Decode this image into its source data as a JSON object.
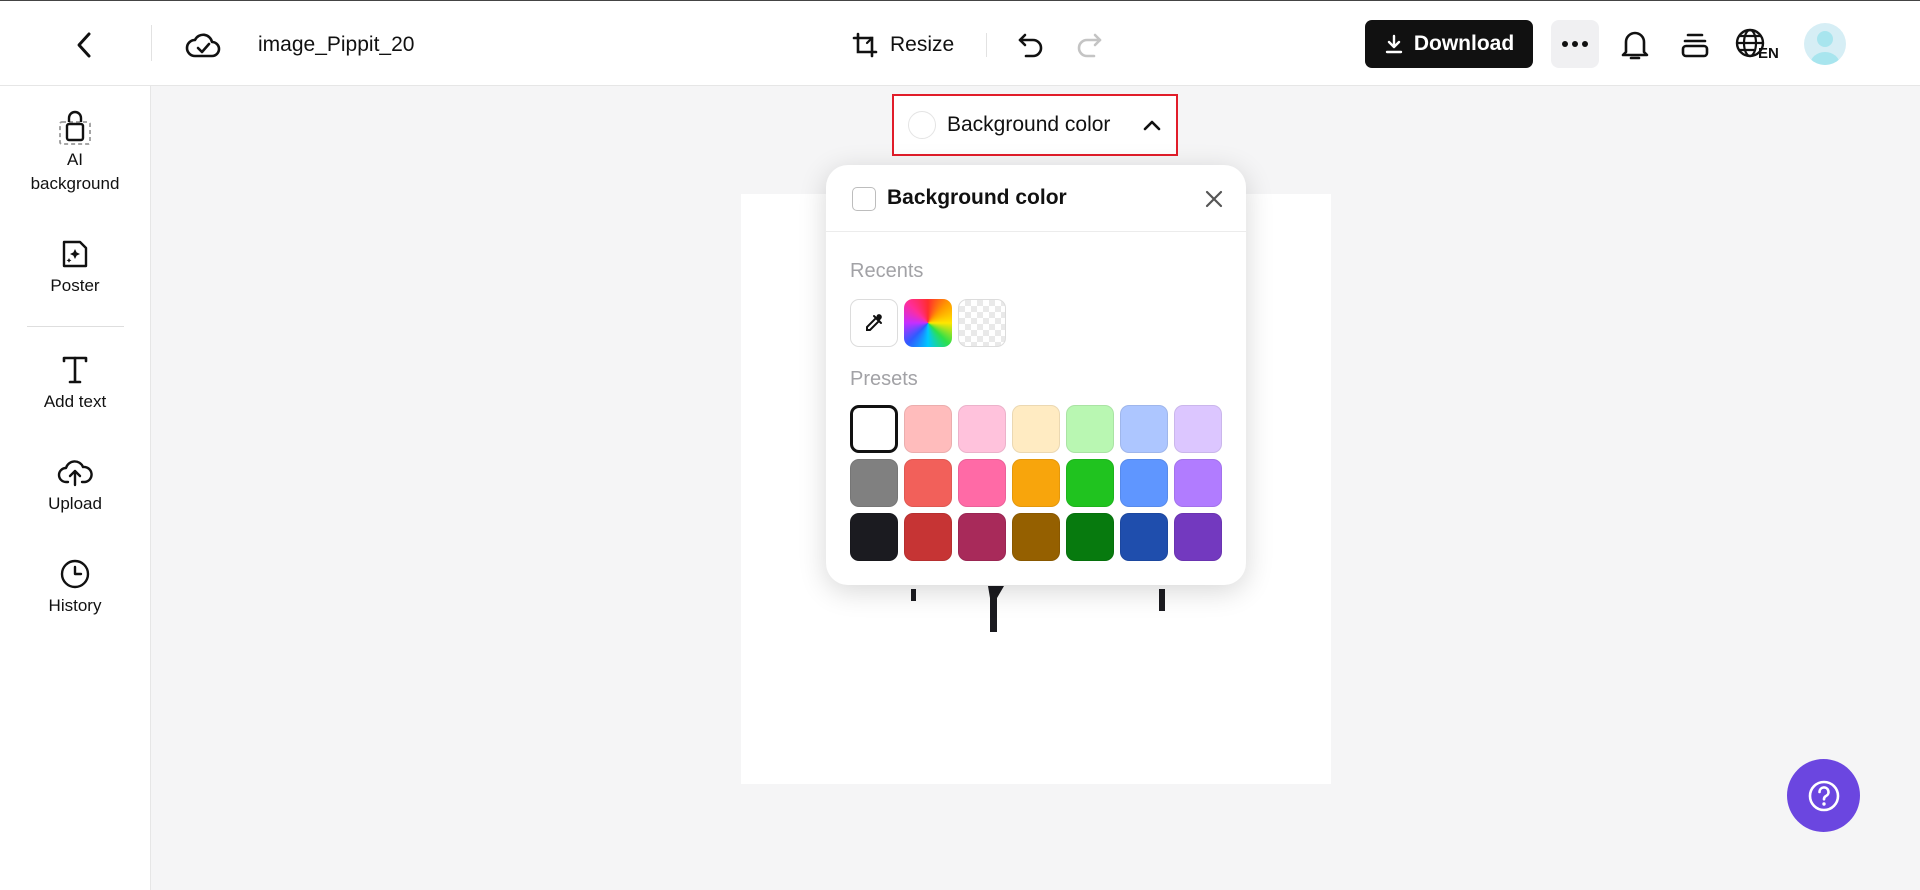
{
  "header": {
    "file_name": "image_Pippit_20",
    "resize_label": "Resize",
    "download_label": "Download",
    "language_code": "EN"
  },
  "sidebar": {
    "items": [
      {
        "label": "AI\nbackground",
        "icon": "lock-bag-icon"
      },
      {
        "label": "Poster",
        "icon": "poster-sparkle-icon"
      },
      {
        "label": "Add text",
        "icon": "text-t-icon"
      },
      {
        "label": "Upload",
        "icon": "cloud-upload-icon"
      },
      {
        "label": "History",
        "icon": "clock-icon"
      }
    ]
  },
  "background_trigger": {
    "label": "Background color",
    "selected_color": "#ffffff"
  },
  "popover": {
    "title": "Background color",
    "recents_label": "Recents",
    "presets_label": "Presets",
    "recents": [
      "eyedropper-icon",
      "rainbow-picker",
      "transparent"
    ],
    "presets": [
      [
        "#ffffff",
        "#ffbcbc",
        "#ffc2dc",
        "#ffebc2",
        "#b9f7b2",
        "#adc6ff",
        "#dcc6ff"
      ],
      [
        "#808080",
        "#f2605a",
        "#ff6aa6",
        "#f8a50c",
        "#20c31f",
        "#5f96ff",
        "#b17cff"
      ],
      [
        "#1b1b20",
        "#c63434",
        "#a82a5a",
        "#956000",
        "#077a0e",
        "#1f4ead",
        "#7339bf"
      ]
    ],
    "selected_preset": "#ffffff"
  },
  "colors": {
    "accent_primary": "#111111",
    "trigger_highlight": "#e11d2a",
    "help_button": "#6b46e0"
  }
}
